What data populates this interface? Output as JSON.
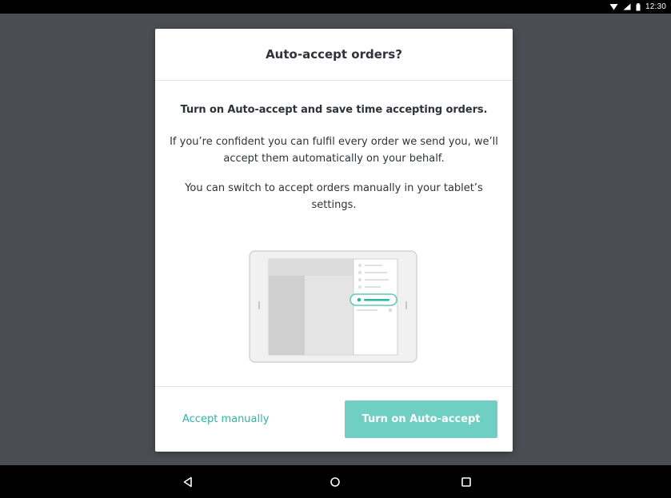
{
  "status_bar": {
    "time": "12:30",
    "icons": [
      "wifi-icon",
      "signal-icon",
      "battery-icon"
    ]
  },
  "dialog": {
    "title": "Auto-accept orders?",
    "lead": "Turn on Auto-accept and save time accepting orders.",
    "paragraph_1": "If you’re confident you can fulfil every order we send you, we’ll accept them automatically on your behalf.",
    "paragraph_2": "You can switch to accept orders manually in your tablet’s settings.",
    "illustration": "tablet-illustration",
    "secondary_button": "Accept manually",
    "primary_button": "Turn on Auto-accept"
  },
  "nav_bar": {
    "buttons": [
      "back-icon",
      "home-icon",
      "recents-icon"
    ]
  },
  "colors": {
    "accent": "#2bb5a6",
    "primary_button_bg": "#6fcfc3",
    "scrim": "#4a4e52",
    "text": "#2d3338"
  }
}
